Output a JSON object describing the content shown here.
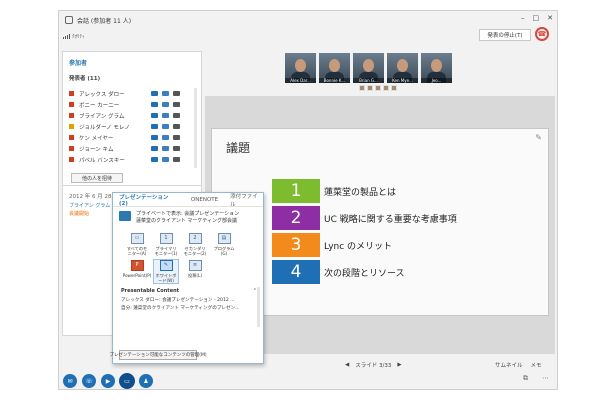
{
  "window": {
    "title": "会話 (参加者 11 人)",
    "controls": [
      "–",
      "□",
      "✕"
    ]
  },
  "signal_label": "ｸｵﾘﾃｨ",
  "participants_panel": {
    "title": "参加者",
    "presenters_label": "発表者 (11)",
    "items": [
      {
        "name": "アレックス ダロー",
        "status": "#d04020"
      },
      {
        "name": "ボニー カーニー",
        "status": "#d04020"
      },
      {
        "name": "ブライアン グラム",
        "status": "#d04020"
      },
      {
        "name": "ジョルダーノ モレノ",
        "status": "#e0a400"
      },
      {
        "name": "ケン メイヤー",
        "status": "#d04020"
      },
      {
        "name": "ジョーン キム",
        "status": "#d04020"
      },
      {
        "name": "パベル バンスキー",
        "status": "#d04020"
      }
    ],
    "invite_label": "他の人を招待"
  },
  "chat": {
    "date": "2012 年 6 月 28 日",
    "sender": "ブライアン グラム",
    "message": "会議開始"
  },
  "toolbar": {
    "stop_presenting": "発表の停止(T)"
  },
  "videos": [
    {
      "name": "Alex Dar..."
    },
    {
      "name": "Bonnie K..."
    },
    {
      "name": "Brian G..."
    },
    {
      "name": "Ken Mye..."
    },
    {
      "name": "Jeo..."
    }
  ],
  "slide": {
    "title": "議題",
    "agenda": [
      {
        "num": "1",
        "text": "蓮菜堂の製品とは",
        "color": "#7dbb2f"
      },
      {
        "num": "2",
        "text": "UC 戦略に関する重要な考慮事項",
        "color": "#8e2ea5"
      },
      {
        "num": "3",
        "text": "Lync のメリット",
        "color": "#f38b1c"
      },
      {
        "num": "4",
        "text": "次の段階とリソース",
        "color": "#1f6fb5"
      }
    ]
  },
  "stage_footer": {
    "prev": "◀",
    "counter": "スライド 3/33",
    "next": "▶",
    "thumbnails": "サムネイル",
    "notes": "メモ"
  },
  "present_popup": {
    "tabs": [
      "プレゼンテーション (2)",
      "ONENOTE",
      "添付ファイル"
    ],
    "private_view": {
      "line1": "プライベートで表示: 会議プレゼンテーション",
      "line2": "蓮菜堂のクライアント マーケティング部会議"
    },
    "grid": [
      {
        "label": "すべてのモニター(A)",
        "icon": "▭"
      },
      {
        "label": "プライマリ モニター(1)",
        "icon": "1"
      },
      {
        "label": "セカンダリ モニター(2)",
        "icon": "2"
      },
      {
        "label": "プログラム(G)",
        "icon": "▤"
      },
      {
        "label": "PowerPoint(P)",
        "icon": "P"
      },
      {
        "label": "ホワイトボード(W)",
        "icon": "✎"
      },
      {
        "label": "投票(L)",
        "icon": "≡"
      }
    ],
    "section_title": "Presentable Content",
    "content_items": [
      "アレックス ダロー: 会議プレゼンテーション - 2012 ...",
      "自分: 蓮菜堂のクライアント マーケティングのプレゼン..."
    ],
    "manage_label": "プレゼンテーション可能なコンテンツの管理(M)"
  }
}
